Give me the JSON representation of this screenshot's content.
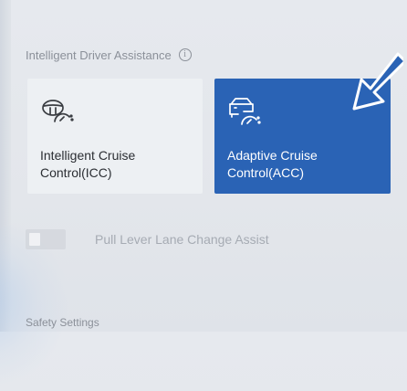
{
  "section": {
    "title": "Intelligent Driver Assistance",
    "info_glyph": "i"
  },
  "cards": {
    "icc": {
      "label": "Intelligent Cruise\nControl(ICC)",
      "icon": "steering-cruise-icon",
      "selected": false
    },
    "acc": {
      "label": "Adaptive Cruise\nControl(ACC)",
      "icon": "car-cruise-icon",
      "selected": true
    }
  },
  "toggle": {
    "label": "Pull Lever Lane Change Assist",
    "state": "off"
  },
  "safety": {
    "title": "Safety Settings"
  },
  "colors": {
    "accent": "#2a63b5",
    "annotation_arrow": "#2a63b5"
  }
}
